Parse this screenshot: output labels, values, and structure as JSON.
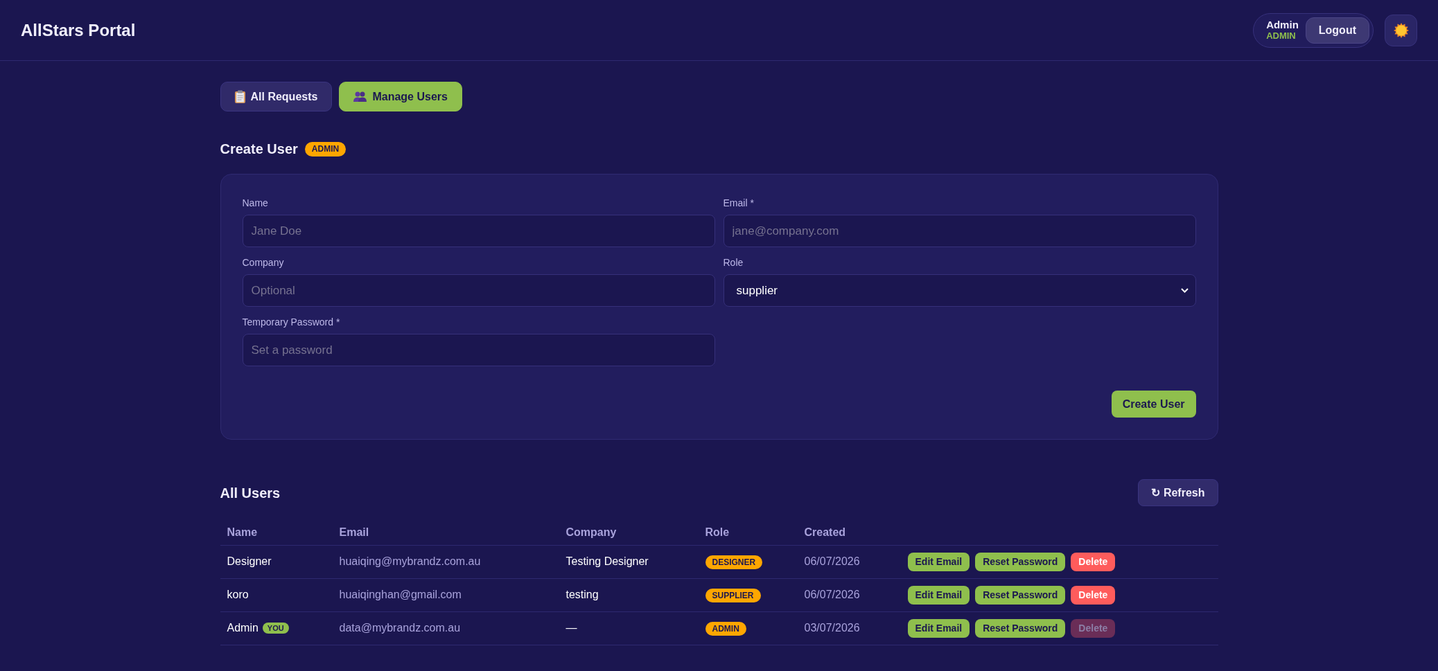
{
  "header": {
    "title": "AllStars Portal",
    "user": {
      "name": "Admin",
      "role": "ADMIN"
    },
    "logout": "Logout"
  },
  "tabs": [
    {
      "label": "All Requests",
      "kind": "requests",
      "selected": false
    },
    {
      "label": "Manage Users",
      "kind": "users",
      "selected": true
    }
  ],
  "create_user": {
    "title": "Create User",
    "badge": "ADMIN",
    "fields": [
      {
        "label": "Name",
        "kind": "text",
        "placeholder": "Jane Doe"
      },
      {
        "label": "Email *",
        "kind": "text",
        "placeholder": "jane@company.com"
      },
      {
        "label": "Company",
        "kind": "text",
        "placeholder": "Optional"
      },
      {
        "label": "Role",
        "kind": "select",
        "value": "supplier"
      },
      {
        "label": "Temporary Password *",
        "kind": "password",
        "placeholder": "Set a password"
      }
    ],
    "submit": "Create User"
  },
  "users": {
    "title": "All Users",
    "refresh": "↻ Refresh",
    "columns": [
      "Name",
      "Email",
      "Company",
      "Role",
      "Created"
    ],
    "rows": [
      {
        "name": "Designer",
        "email": "huaiqing@mybrandz.com.au",
        "company": "Testing Designer",
        "role": "DESIGNER",
        "created": "06/07/2026",
        "actions": [
          {
            "label": "Edit Email",
            "kind": "primary",
            "disabled": false
          },
          {
            "label": "Reset Password",
            "kind": "primary",
            "disabled": false
          },
          {
            "label": "Delete",
            "kind": "danger",
            "disabled": false
          }
        ]
      },
      {
        "name": "koro",
        "email": "huaiqinghan@gmail.com",
        "company": "testing",
        "role": "SUPPLIER",
        "created": "06/07/2026",
        "actions": [
          {
            "label": "Edit Email",
            "kind": "primary",
            "disabled": false
          },
          {
            "label": "Reset Password",
            "kind": "primary",
            "disabled": false
          },
          {
            "label": "Delete",
            "kind": "danger",
            "disabled": false
          }
        ]
      },
      {
        "name": "Admin",
        "badge": "YOU",
        "email": "data@mybrandz.com.au",
        "company": "—",
        "role": "ADMIN",
        "created": "03/07/2026",
        "actions": [
          {
            "label": "Edit Email",
            "kind": "primary",
            "disabled": false
          },
          {
            "label": "Reset Password",
            "kind": "primary",
            "disabled": false
          },
          {
            "label": "Delete",
            "kind": "danger",
            "disabled": true
          }
        ]
      }
    ]
  }
}
